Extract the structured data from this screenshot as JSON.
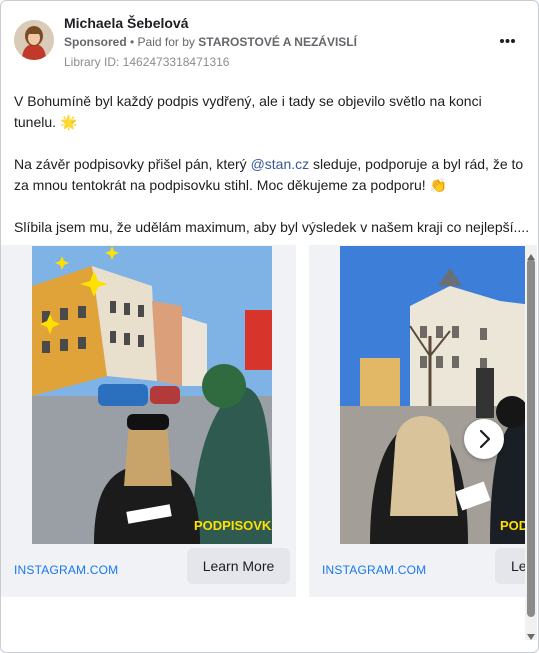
{
  "post": {
    "author": "Michaela Šebelová",
    "sponsored_label": "Sponsored",
    "paid_for_label": "• Paid for by",
    "paid_by": "STAROSTOVÉ A NEZÁVISLÍ",
    "library_id": "Library ID: 1462473318471316",
    "text": {
      "p1": "V Bohumíně byl každý podpis vydřený, ale i tady se objevilo světlo na konci tunelu.",
      "p1_emoji": "🌟",
      "p2_a": "Na závěr podpisovky přišel pán, který ",
      "p2_mention": "@stan.cz",
      "p2_b": " sleduje, podporuje a byl rád, že to za mnou tentokrát na podpisovku stihl. Moc děkujeme za podporu!",
      "p2_emoji": "👏",
      "p3": "Slíbila jsem mu, že udělám maximum, aby byl výsledek v našem kraji co nejlepší...."
    }
  },
  "carousel": {
    "cards": [
      {
        "photo_caption": "PODPISOVKA",
        "link": "INSTAGRAM.COM",
        "button": "Learn More"
      },
      {
        "photo_caption": "PODPISOVKA",
        "link": "INSTAGRAM.COM",
        "button": "Le"
      }
    ]
  },
  "icons": {
    "more": "ellipsis-icon",
    "next": "chevron-right-icon"
  }
}
